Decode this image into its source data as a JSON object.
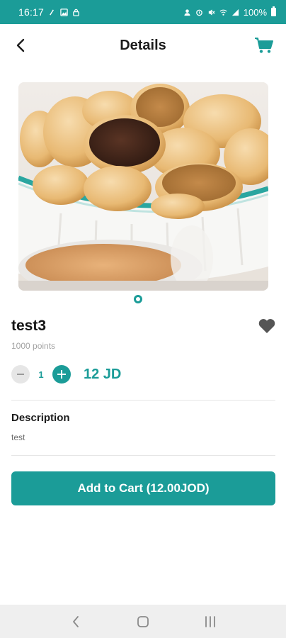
{
  "status_bar": {
    "time": "16:17",
    "battery": "100%"
  },
  "header": {
    "title": "Details"
  },
  "product": {
    "name": "test3",
    "points": "1000 points",
    "quantity": "1",
    "price": "12 JD",
    "image_icon": "cookie-bowl-photo"
  },
  "description": {
    "title": "Description",
    "text": "test"
  },
  "actions": {
    "add_to_cart_label": "Add to Cart (12.00JOD)"
  },
  "carousel": {
    "active_index": 0,
    "count": 1
  },
  "colors": {
    "primary": "#1b9c98",
    "text_dark": "#1c1c1c",
    "muted": "#a3a3a3",
    "fav_icon": "#555555"
  }
}
